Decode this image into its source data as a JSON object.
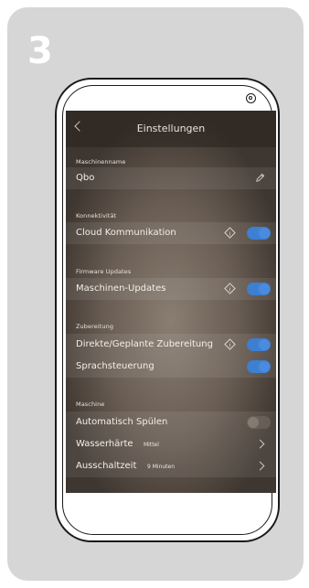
{
  "step": "3",
  "header": {
    "title": "Einstellungen"
  },
  "sections": {
    "maschinenname": {
      "label": "Maschinenname",
      "value": "Qbo"
    },
    "konnektivitaet": {
      "label": "Konnektivität",
      "cloud": "Cloud Kommunikation",
      "cloud_on": true
    },
    "firmware": {
      "label": "Firmware Updates",
      "updates": "Maschinen-Updates",
      "updates_on": true
    },
    "zubereitung": {
      "label": "Zubereitung",
      "direkt": "Direkte/Geplante Zubereitung",
      "direkt_on": true,
      "sprache": "Sprachsteuerung",
      "sprache_on": true
    },
    "maschine": {
      "label": "Maschine",
      "spuelen": "Automatisch Spülen",
      "spuelen_on": false,
      "haerte": "Wasserhärte",
      "haerte_value": "Mittel",
      "ausschalt": "Ausschaltzeit",
      "ausschalt_value": "9 Minuten"
    }
  },
  "colors": {
    "toggle_on": "#3d7fd0",
    "card": "#d6d6d6"
  }
}
